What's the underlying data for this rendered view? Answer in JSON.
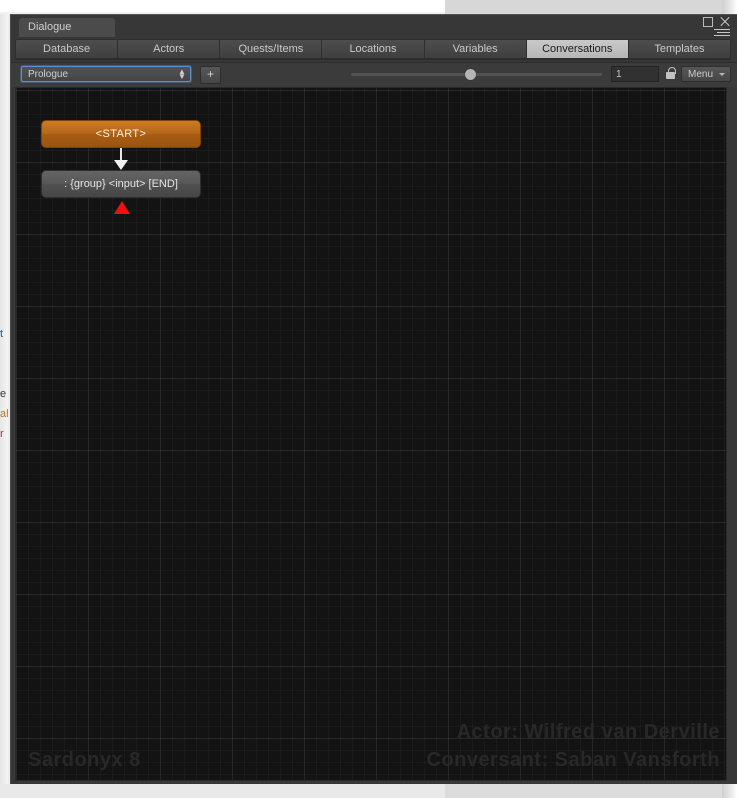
{
  "window": {
    "tab_title": "Dialogue",
    "controls": {
      "maximize": "maximize-icon",
      "close": "close-icon",
      "options_menu": "hamburger-menu-icon"
    }
  },
  "tabs": [
    {
      "label": "Database",
      "active": false
    },
    {
      "label": "Actors",
      "active": false
    },
    {
      "label": "Quests/Items",
      "active": false
    },
    {
      "label": "Locations",
      "active": false
    },
    {
      "label": "Variables",
      "active": false
    },
    {
      "label": "Conversations",
      "active": true
    },
    {
      "label": "Templates",
      "active": false
    }
  ],
  "toolbar": {
    "conversation_select": {
      "value": "Prologue",
      "icon": "updown-arrows-icon"
    },
    "add_button_label": "+",
    "zoom_slider": {
      "value": 1,
      "knob_position_pct": 45
    },
    "zoom_value": "1",
    "lock_icon": "unlocked-padlock-icon",
    "menu_dropdown": {
      "label": "Menu",
      "icon": "chevron-down-icon"
    }
  },
  "canvas": {
    "nodes": [
      {
        "id": "start",
        "label": "<START>"
      },
      {
        "id": "entry",
        "label": ": {group} <input> [END]"
      }
    ],
    "link_arrow_icon": "down-arrow-icon",
    "red_marker_icon": "red-triangle-marker-icon",
    "watermarks": {
      "bottom_left": "Sardonyx 8",
      "actor": "Actor: Wilfred van Derville",
      "conversant": "Conversant: Saban Vansforth"
    },
    "colors": {
      "start_node": "#b5661a",
      "entry_node": "#585858",
      "marker_red": "#ee0f0f",
      "background": "#131313"
    }
  },
  "background_fragments": {
    "frag1": "t",
    "frag2": "e",
    "frag3": "al",
    "frag4": "r"
  }
}
